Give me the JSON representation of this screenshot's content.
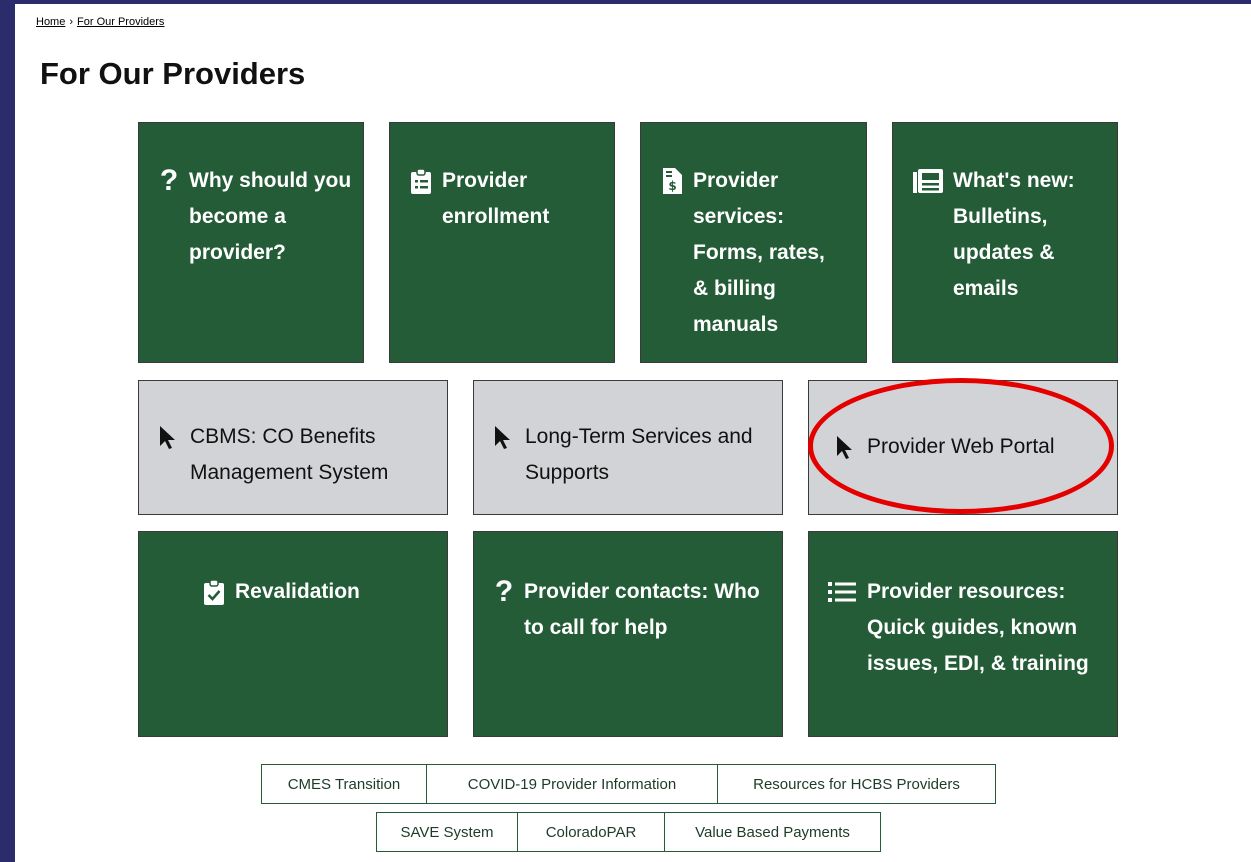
{
  "breadcrumb": {
    "home": "Home",
    "separator": "›",
    "current": "For Our Providers"
  },
  "page": {
    "title": "For Our Providers"
  },
  "tiles": {
    "why": {
      "label": "Why should you become a provider?",
      "icon": "question-icon"
    },
    "enrollment": {
      "label": "Provider enrollment",
      "icon": "clipboard-list-icon"
    },
    "services": {
      "label": "Provider services: Forms, rates, & billing manuals",
      "icon": "invoice-dollar-icon"
    },
    "news": {
      "label": "What's new: Bulletins, updates & emails",
      "icon": "newspaper-icon"
    },
    "cbms": {
      "label": "CBMS: CO Benefits Management System",
      "icon": "pointer-icon"
    },
    "ltss": {
      "label": "Long-Term Services and Supports",
      "icon": "pointer-icon"
    },
    "portal": {
      "label": "Provider Web Portal",
      "icon": "pointer-icon"
    },
    "revalidation": {
      "label": "Revalidation",
      "icon": "clipboard-check-icon"
    },
    "contacts": {
      "label": "Provider contacts: Who to call for help",
      "icon": "question-icon"
    },
    "resources": {
      "label": "Provider resources: Quick guides, known issues, EDI, & training",
      "icon": "list-icon"
    }
  },
  "links_row1": [
    "CMES Transition",
    "COVID-19 Provider Information",
    "Resources for HCBS Providers"
  ],
  "links_row2": [
    "SAVE System",
    "ColoradoPAR",
    "Value Based Payments"
  ],
  "colors": {
    "green": "#255c38",
    "gray": "#d2d3d6",
    "frame": "#2b2c6b",
    "highlight": "#e50000"
  }
}
